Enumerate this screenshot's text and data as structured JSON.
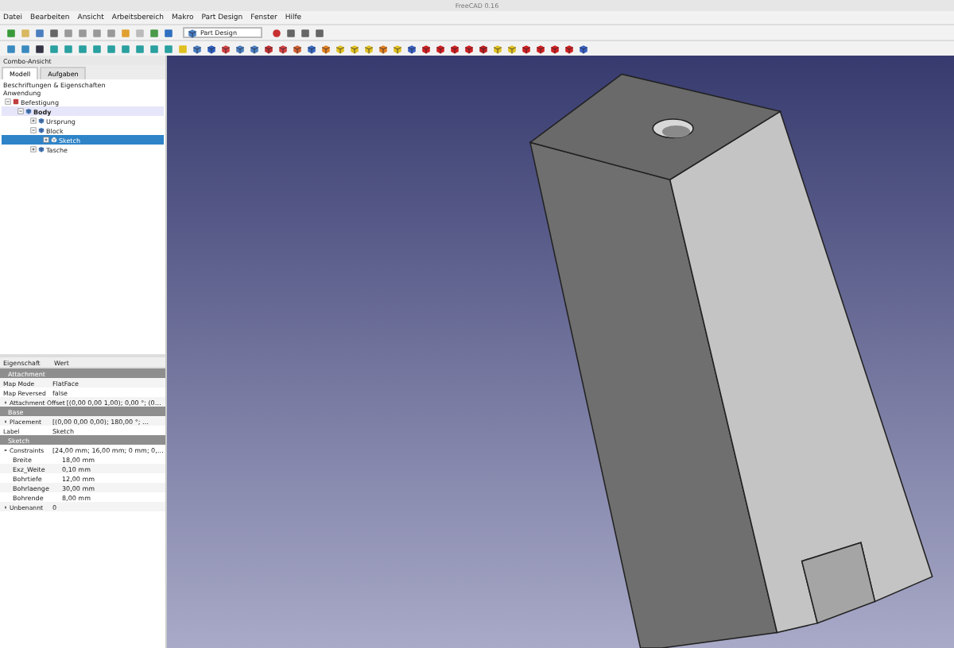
{
  "window": {
    "title": "FreeCAD 0.16"
  },
  "menu": [
    "Datei",
    "Bearbeiten",
    "Ansicht",
    "Arbeitsbereich",
    "Makro",
    "Part Design",
    "Fenster",
    "Hilfe"
  ],
  "workbench": {
    "value": "Part Design"
  },
  "combo_view": {
    "title": "Combo-Ansicht",
    "tabs": [
      {
        "label": "Modell",
        "selected": true
      },
      {
        "label": "Aufgaben",
        "selected": false
      }
    ],
    "section": "Beschriftungen & Eigenschaften",
    "root": "Anwendung",
    "tree": [
      {
        "label": "Befestigung",
        "expanded": true,
        "selected": false,
        "children": [
          {
            "label": "Body",
            "expanded": true,
            "selected": false,
            "active": true,
            "children": [
              {
                "label": "Ursprung",
                "expanded": false,
                "selected": false,
                "active": false
              },
              {
                "label": "Block",
                "expanded": true,
                "selected": false,
                "active": false,
                "children": [
                  {
                    "label": "Sketch",
                    "expanded": false,
                    "selected": true,
                    "active": false
                  }
                ]
              },
              {
                "label": "Tasche",
                "expanded": false,
                "selected": false,
                "active": false
              }
            ]
          }
        ]
      }
    ]
  },
  "properties": {
    "columns": [
      "Eigenschaft",
      "Wert"
    ],
    "rows": [
      {
        "kind": "group",
        "label": "Attachment"
      },
      {
        "kind": "prop",
        "name": "Map Mode",
        "value": "FlatFace"
      },
      {
        "kind": "prop",
        "name": "Map Reversed",
        "value": "false"
      },
      {
        "kind": "prop",
        "name": "Attachment Offset",
        "value": "[(0,00 0,00 1,00); 0,00 °; (0…",
        "expanded": false
      },
      {
        "kind": "group",
        "label": "Base"
      },
      {
        "kind": "prop",
        "name": "Placement",
        "value": "[(0,00 0,00 0,00); 180,00 °; …",
        "expanded": false
      },
      {
        "kind": "prop",
        "name": "Label",
        "value": "Sketch"
      },
      {
        "kind": "group",
        "label": "Sketch"
      },
      {
        "kind": "prop",
        "name": "Constraints",
        "value": "[24,00 mm; 16,00 mm; 0 mm; 0,…",
        "expanded": true,
        "children": [
          {
            "name": "Breite",
            "value": "18,00 mm"
          },
          {
            "name": "Exz_Weite",
            "value": "0,10 mm"
          },
          {
            "name": "Bohrtiefe",
            "value": "12,00 mm"
          },
          {
            "name": "Bohrlaenge",
            "value": "30,00 mm"
          },
          {
            "name": "Bohrende",
            "value": "8,00 mm"
          }
        ]
      },
      {
        "kind": "prop",
        "name": "Unbenannt",
        "value": "0",
        "expanded": false
      }
    ]
  }
}
